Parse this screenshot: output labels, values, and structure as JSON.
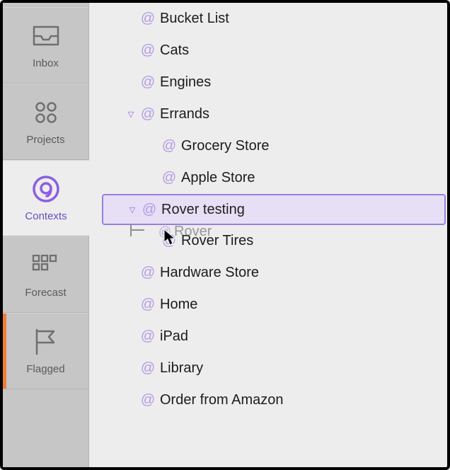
{
  "sidebar": {
    "items": [
      {
        "name": "inbox",
        "label": "Inbox"
      },
      {
        "name": "projects",
        "label": "Projects"
      },
      {
        "name": "contexts",
        "label": "Contexts"
      },
      {
        "name": "forecast",
        "label": "Forecast"
      },
      {
        "name": "flagged",
        "label": "Flagged"
      }
    ],
    "active": "contexts"
  },
  "contexts": {
    "items": [
      {
        "name": "bucket-list",
        "label": "Bucket List",
        "indent": 0,
        "expanded": false,
        "hasChildren": false,
        "selected": false
      },
      {
        "name": "cats",
        "label": "Cats",
        "indent": 0,
        "expanded": false,
        "hasChildren": false,
        "selected": false
      },
      {
        "name": "engines",
        "label": "Engines",
        "indent": 0,
        "expanded": false,
        "hasChildren": false,
        "selected": false
      },
      {
        "name": "errands",
        "label": "Errands",
        "indent": 0,
        "expanded": true,
        "hasChildren": true,
        "selected": false
      },
      {
        "name": "grocery-store",
        "label": "Grocery Store",
        "indent": 1,
        "expanded": false,
        "hasChildren": false,
        "selected": false
      },
      {
        "name": "apple-store",
        "label": "Apple Store",
        "indent": 1,
        "expanded": false,
        "hasChildren": false,
        "selected": false
      },
      {
        "name": "rover-testing",
        "label": "Rover testing",
        "indent": 0,
        "expanded": true,
        "hasChildren": true,
        "selected": true
      },
      {
        "name": "rover-tires",
        "label": "Rover Tires",
        "indent": 1,
        "expanded": false,
        "hasChildren": false,
        "selected": false
      },
      {
        "name": "hardware-store",
        "label": "Hardware Store",
        "indent": 0,
        "expanded": false,
        "hasChildren": false,
        "selected": false
      },
      {
        "name": "home",
        "label": "Home",
        "indent": 0,
        "expanded": false,
        "hasChildren": false,
        "selected": false
      },
      {
        "name": "ipad",
        "label": "iPad",
        "indent": 0,
        "expanded": false,
        "hasChildren": false,
        "selected": false
      },
      {
        "name": "library",
        "label": "Library",
        "indent": 0,
        "expanded": false,
        "hasChildren": false,
        "selected": false
      },
      {
        "name": "order-amazon",
        "label": "Order from Amazon",
        "indent": 0,
        "expanded": false,
        "hasChildren": false,
        "selected": false
      }
    ]
  },
  "drag": {
    "ghost_label": "Rover"
  },
  "glyphs": {
    "at": "@",
    "disclosure_expanded": "▽"
  }
}
